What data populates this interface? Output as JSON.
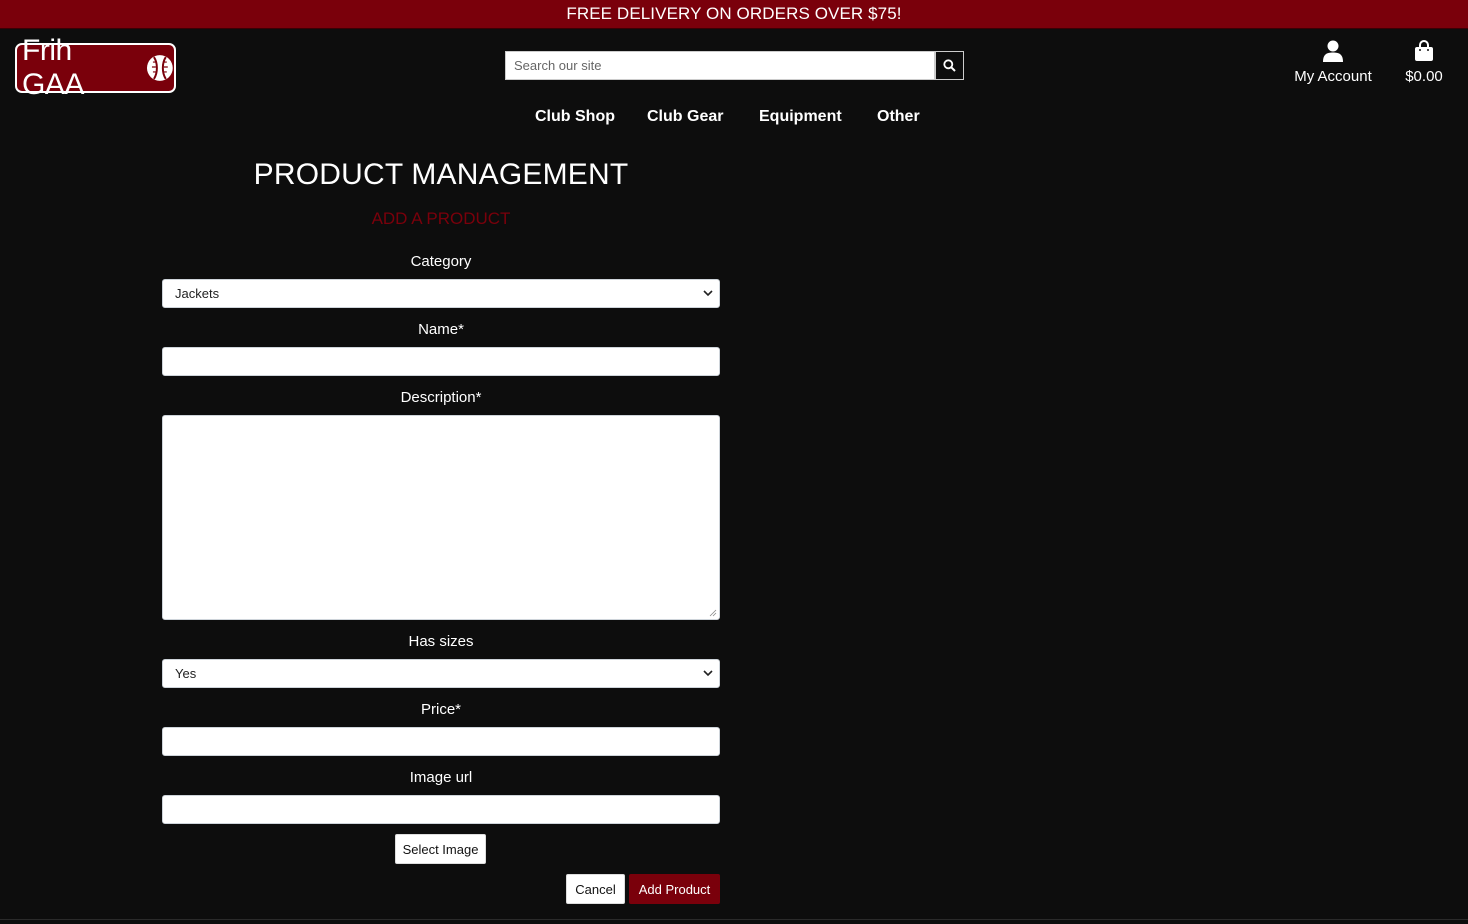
{
  "banner": {
    "text": "FREE DELIVERY ON ORDERS OVER $75!"
  },
  "logo": {
    "text": "Frih GAA",
    "icon": "sliotar-ball-icon"
  },
  "search": {
    "placeholder": "Search our site",
    "value": "",
    "icon": "search-icon"
  },
  "account": {
    "label": "My Account",
    "icon": "user-icon"
  },
  "bag": {
    "total": "$0.00",
    "icon": "shopping-bag-icon"
  },
  "nav": {
    "items": [
      "Club Shop",
      "Club Gear",
      "Equipment",
      "Other"
    ]
  },
  "page": {
    "title": "PRODUCT MANAGEMENT",
    "subtitle": "ADD A PRODUCT"
  },
  "form": {
    "category_label": "Category",
    "category_value": "Jackets",
    "name_label": "Name*",
    "name_value": "",
    "description_label": "Description*",
    "description_value": "",
    "has_sizes_label": "Has sizes",
    "has_sizes_value": "Yes",
    "price_label": "Price*",
    "price_value": "",
    "image_url_label": "Image url",
    "image_url_value": "",
    "select_image_label": "Select Image",
    "cancel_label": "Cancel",
    "submit_label": "Add Product"
  },
  "colors": {
    "brand": "#7a000b",
    "background": "#0d0d0d",
    "text": "#ffffff"
  }
}
